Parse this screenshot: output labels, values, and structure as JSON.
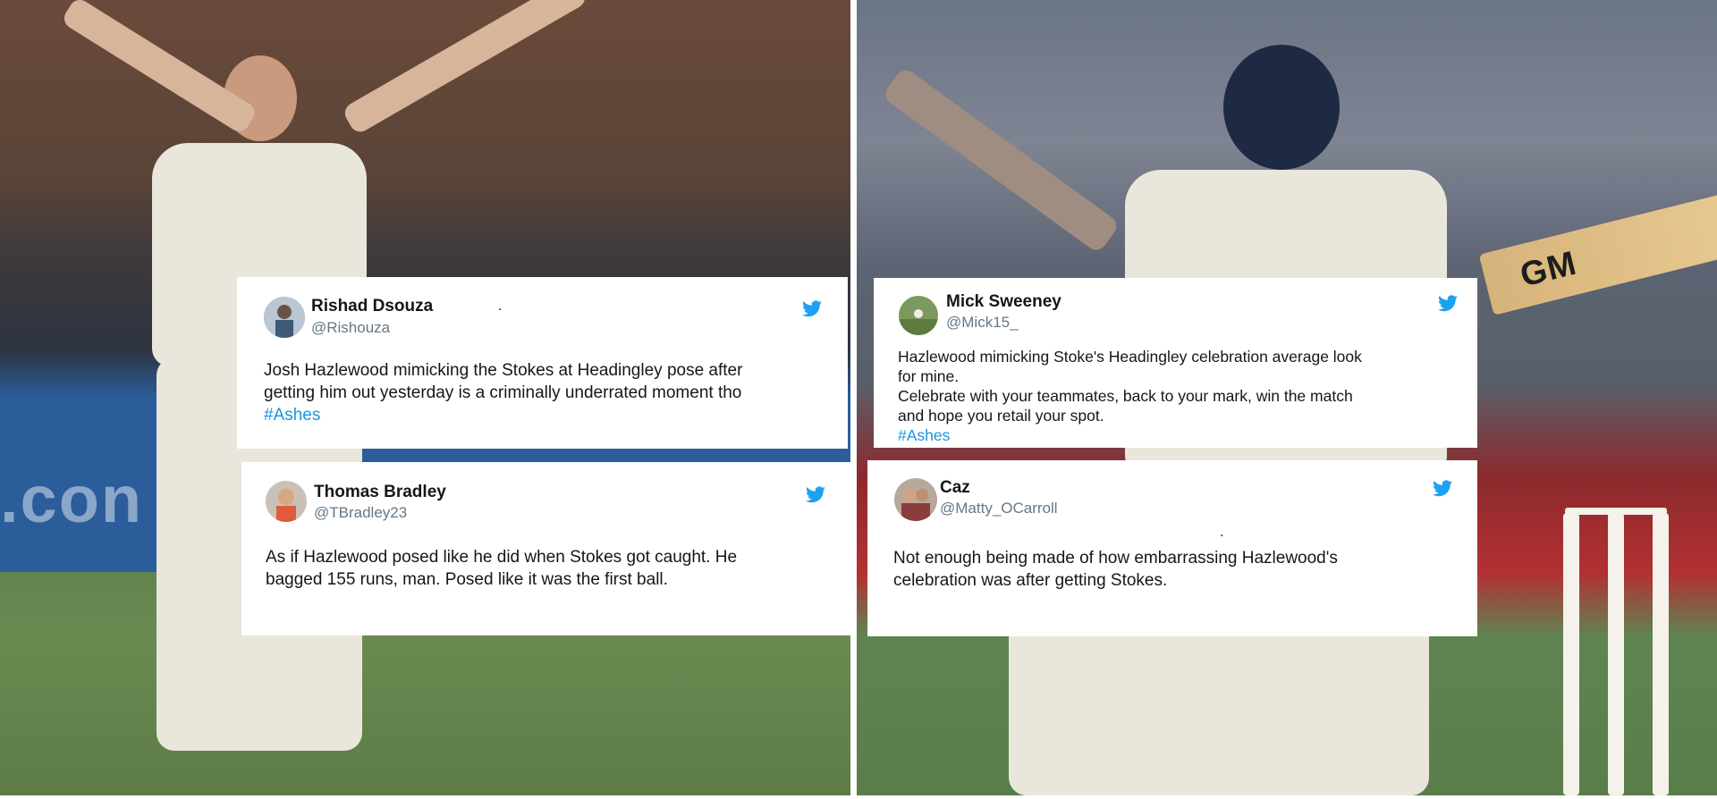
{
  "tweets": [
    {
      "name": "Rishad Dsouza",
      "handle": "@Rishouza",
      "lines": [
        "Josh Hazlewood mimicking the Stokes at Headingley pose after",
        "getting him out yesterday is a criminally underrated moment tho"
      ],
      "hashtag": "#Ashes",
      "icon": "twitter-bird-icon"
    },
    {
      "name": "Thomas Bradley",
      "handle": "@TBradley23",
      "lines": [
        "As if Hazlewood posed like he did when Stokes got caught. He",
        "bagged 155 runs, man. Posed like it was the first ball."
      ],
      "icon": "twitter-bird-icon"
    },
    {
      "name": "Mick Sweeney",
      "handle": "@Mick15_",
      "lines": [
        "Hazlewood mimicking Stoke's Headingley celebration average look",
        "for mine.",
        "Celebrate with your teammates, back to your mark, win the match",
        "and hope you retail your spot."
      ],
      "hashtag": "#Ashes",
      "icon": "twitter-bird-icon"
    },
    {
      "name": "Caz",
      "handle": "@Matty_OCarroll",
      "lines": [
        "Not enough being made of how embarrassing Hazlewood's",
        "celebration was after getting Stokes."
      ],
      "icon": "twitter-bird-icon"
    }
  ],
  "background": {
    "bat_brand": "GM",
    "ad_board_text": ".con",
    "colors": {
      "twitter_blue": "#1da1f2",
      "hashtag_blue": "#1b95e0",
      "handle_gray": "#657786",
      "card_bg": "#ffffff"
    }
  }
}
